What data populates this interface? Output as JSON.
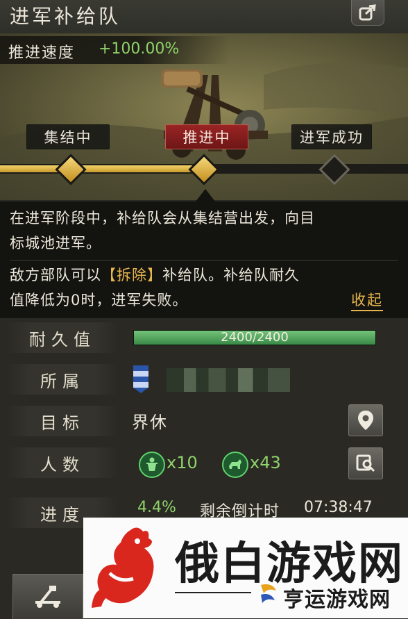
{
  "header": {
    "title": "进军补给队"
  },
  "scene": {
    "speed_label": "推进速度",
    "speed_value": "+100.00%"
  },
  "stages": [
    {
      "label": "集结中",
      "status": "done"
    },
    {
      "label": "推进中",
      "status": "active"
    },
    {
      "label": "进军成功",
      "status": "pending"
    }
  ],
  "track": {
    "progress_fraction": 0.5
  },
  "info": {
    "line1": "在进军阶段中，补给队会从集结营出发，向目",
    "line2": "标城池进军。",
    "line3_pre": "敌方部队可以",
    "line3_highlight": "【拆除】",
    "line3_post": "补给队。补给队耐久",
    "line4": "值降低为0时，进军失败。",
    "collapse": "收起"
  },
  "stats": {
    "durability_label": "耐久值",
    "durability_current": 2400,
    "durability_max": 2400,
    "durability_text": "2400/2400",
    "owner_label": "所属",
    "target_label": "目标",
    "target_value": "界休",
    "count_label": "人数",
    "troops": [
      {
        "icon": "infantry-icon",
        "count": "x10"
      },
      {
        "icon": "cavalry-icon",
        "count": "x43"
      }
    ],
    "progress_label": "进度",
    "progress_value": "4.4%",
    "countdown_label": "剩余倒计时",
    "countdown_value": "07:38:47"
  },
  "watermark": {
    "brand": "俄白游戏网",
    "sub": "亨运游戏网"
  },
  "colors": {
    "accent_gold": "#e6b54d",
    "accent_green": "#8fd36a",
    "active_red": "#9a2424",
    "hp_green": "#4fa65c"
  }
}
